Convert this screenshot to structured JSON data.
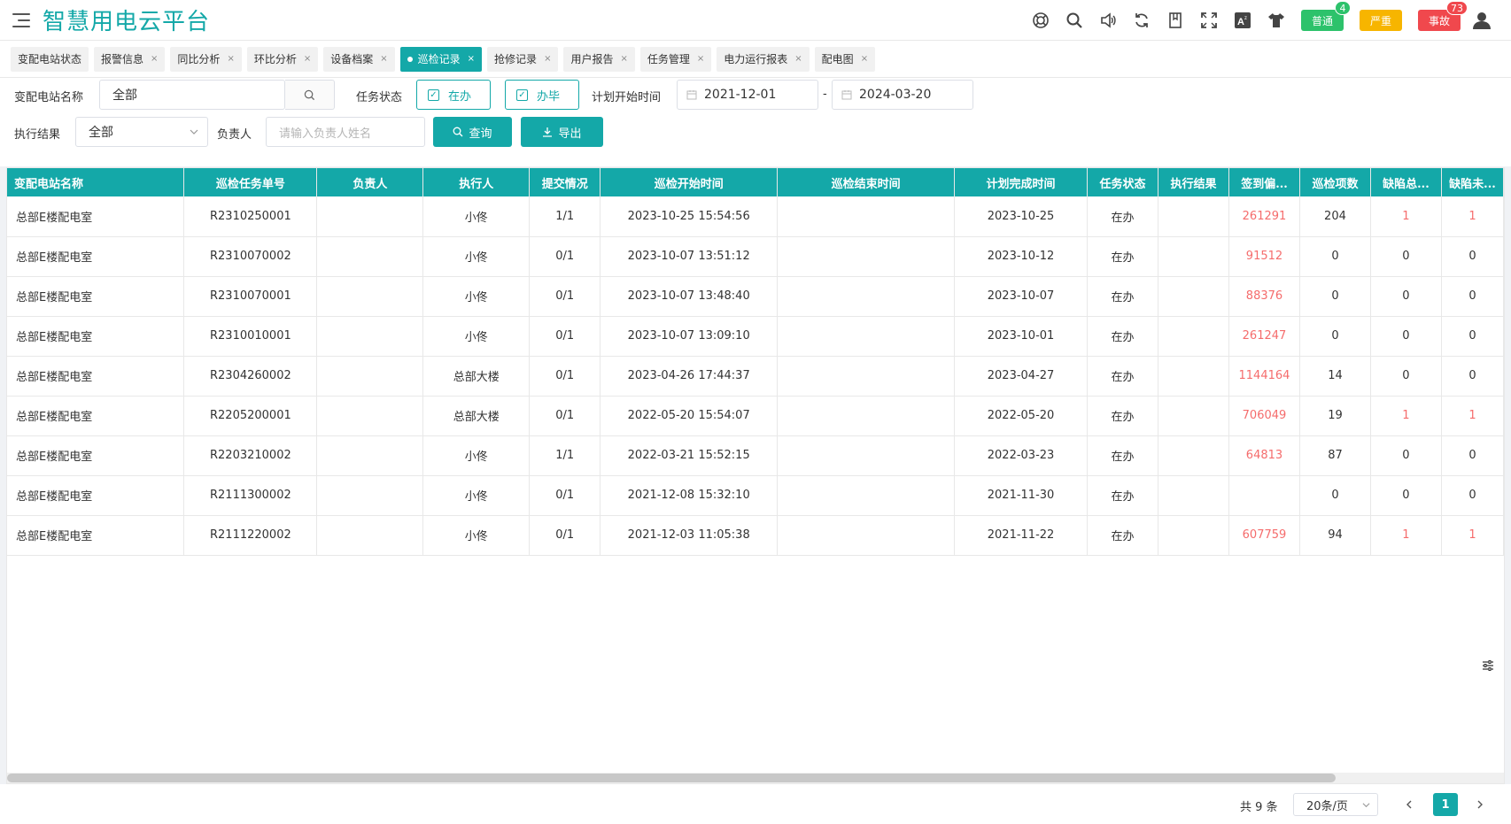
{
  "app": {
    "title": "智慧用电云平台"
  },
  "header": {
    "icons": [
      "support-icon",
      "search-icon",
      "volume-icon",
      "refresh-icon",
      "bookmark-icon",
      "fullscreen-icon",
      "translate-icon",
      "skin-icon"
    ],
    "alerts": [
      {
        "label": "普通",
        "count": "4",
        "color": "#2dc26b",
        "count_color": "#2dc26b"
      },
      {
        "label": "严重",
        "count": "",
        "color": "#f7b500",
        "count_color": "#f7b500"
      },
      {
        "label": "事故",
        "count": "73",
        "color": "#f0484d",
        "count_color": "#f0484d"
      }
    ]
  },
  "tabs": [
    {
      "label": "变配电站状态",
      "closable": false
    },
    {
      "label": "报警信息",
      "closable": true
    },
    {
      "label": "同比分析",
      "closable": true
    },
    {
      "label": "环比分析",
      "closable": true
    },
    {
      "label": "设备档案",
      "closable": true
    },
    {
      "label": "巡检记录",
      "closable": true,
      "active": true
    },
    {
      "label": "抢修记录",
      "closable": true
    },
    {
      "label": "用户报告",
      "closable": true
    },
    {
      "label": "任务管理",
      "closable": true
    },
    {
      "label": "电力运行报表",
      "closable": true
    },
    {
      "label": "配电图",
      "closable": true
    }
  ],
  "filters": {
    "station_label": "变配电站名称",
    "station_value": "全部",
    "status_label": "任务状态",
    "status_opt1": "在办",
    "status_opt2": "办毕",
    "plan_start_label": "计划开始时间",
    "date_from": "2021-12-01",
    "date_sep": "-",
    "date_to": "2024-03-20",
    "result_label": "执行结果",
    "result_value": "全部",
    "owner_label": "负责人",
    "owner_placeholder": "请输入负责人姓名",
    "query_label": "查询",
    "export_label": "导出"
  },
  "table": {
    "columns": [
      "变配电站名称",
      "巡检任务单号",
      "负责人",
      "执行人",
      "提交情况",
      "巡检开始时间",
      "巡检结束时间",
      "计划完成时间",
      "任务状态",
      "执行结果",
      "签到偏...",
      "巡检项数",
      "缺陷总...",
      "缺陷未..."
    ],
    "rows": [
      [
        "总部E楼配电室",
        "R2310250001",
        "",
        "小佟",
        "1/1",
        "2023-10-25 15:54:56",
        "",
        "2023-10-25",
        "在办",
        "",
        "261291",
        "204",
        "1",
        "1"
      ],
      [
        "总部E楼配电室",
        "R2310070002",
        "",
        "小佟",
        "0/1",
        "2023-10-07 13:51:12",
        "",
        "2023-10-12",
        "在办",
        "",
        "91512",
        "0",
        "0",
        "0"
      ],
      [
        "总部E楼配电室",
        "R2310070001",
        "",
        "小佟",
        "0/1",
        "2023-10-07 13:48:40",
        "",
        "2023-10-07",
        "在办",
        "",
        "88376",
        "0",
        "0",
        "0"
      ],
      [
        "总部E楼配电室",
        "R2310010001",
        "",
        "小佟",
        "0/1",
        "2023-10-07 13:09:10",
        "",
        "2023-10-01",
        "在办",
        "",
        "261247",
        "0",
        "0",
        "0"
      ],
      [
        "总部E楼配电室",
        "R2304260002",
        "",
        "总部大楼",
        "0/1",
        "2023-04-26 17:44:37",
        "",
        "2023-04-27",
        "在办",
        "",
        "1144164",
        "14",
        "0",
        "0"
      ],
      [
        "总部E楼配电室",
        "R2205200001",
        "",
        "总部大楼",
        "0/1",
        "2022-05-20 15:54:07",
        "",
        "2022-05-20",
        "在办",
        "",
        "706049",
        "19",
        "1",
        "1"
      ],
      [
        "总部E楼配电室",
        "R2203210002",
        "",
        "小佟",
        "1/1",
        "2022-03-21 15:52:15",
        "",
        "2022-03-23",
        "在办",
        "",
        "64813",
        "87",
        "0",
        "0"
      ],
      [
        "总部E楼配电室",
        "R2111300002",
        "",
        "小佟",
        "0/1",
        "2021-12-08 15:32:10",
        "",
        "2021-11-30",
        "在办",
        "",
        "",
        "0",
        "0",
        "0"
      ],
      [
        "总部E楼配电室",
        "R2111220002",
        "",
        "小佟",
        "0/1",
        "2021-12-03 11:05:38",
        "",
        "2021-11-22",
        "在办",
        "",
        "607759",
        "94",
        "1",
        "1"
      ]
    ]
  },
  "pagination": {
    "total": "共 9 条",
    "page_size": "20条/页",
    "current_page": "1"
  },
  "colors": {
    "accent": "#14a8a8",
    "danger": "#f56c6c"
  }
}
